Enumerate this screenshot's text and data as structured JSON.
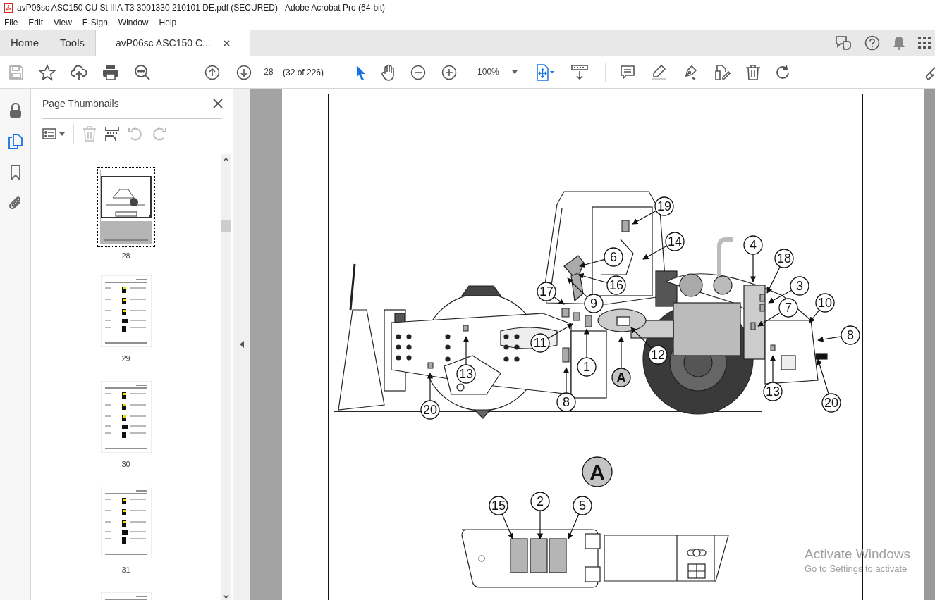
{
  "window": {
    "title": "avP06sc ASC150 CU St IIIA T3 3001330 210101 DE.pdf (SECURED) - Adobe Acrobat Pro (64-bit)"
  },
  "menu": [
    "File",
    "Edit",
    "View",
    "E-Sign",
    "Window",
    "Help"
  ],
  "tabs": [
    {
      "label": "Home",
      "kind": "nav",
      "selected": false
    },
    {
      "label": "Tools",
      "kind": "nav",
      "selected": false
    },
    {
      "label": "avP06sc ASC150 C...",
      "kind": "document",
      "selected": true
    }
  ],
  "toolbar": {
    "page_number": "28",
    "page_count": "(32 of 226)",
    "zoom": "100%",
    "tools": [
      {
        "kind": "select",
        "selected": true
      },
      {
        "kind": "hand",
        "selected": false
      }
    ]
  },
  "rail": [
    {
      "kind": "lock",
      "selected": false
    },
    {
      "kind": "pages",
      "selected": true
    },
    {
      "kind": "bookmark",
      "selected": false
    },
    {
      "kind": "attachment",
      "selected": false
    }
  ],
  "sidebar": {
    "title": "Page Thumbnails",
    "thumbnails": [
      {
        "page": "28",
        "kind": "drawing",
        "selected": true
      },
      {
        "page": "29",
        "kind": "table",
        "selected": false
      },
      {
        "page": "30",
        "kind": "table",
        "selected": false
      },
      {
        "page": "31",
        "kind": "table",
        "selected": false
      },
      {
        "kind": "table",
        "selected": false
      }
    ]
  },
  "document": {
    "callouts": [
      {
        "label": "19",
        "kind": "number"
      },
      {
        "label": "14",
        "kind": "number"
      },
      {
        "label": "6",
        "kind": "number"
      },
      {
        "label": "16",
        "kind": "number"
      },
      {
        "label": "9",
        "kind": "number"
      },
      {
        "label": "17",
        "kind": "number"
      },
      {
        "label": "11",
        "kind": "number"
      },
      {
        "label": "13",
        "kind": "number"
      },
      {
        "label": "20",
        "kind": "number"
      },
      {
        "label": "8",
        "kind": "number"
      },
      {
        "label": "1",
        "kind": "number"
      },
      {
        "label": "A",
        "kind": "view"
      },
      {
        "label": "12",
        "kind": "number"
      },
      {
        "label": "4",
        "kind": "number"
      },
      {
        "label": "18",
        "kind": "number"
      },
      {
        "label": "3",
        "kind": "number"
      },
      {
        "label": "7",
        "kind": "number"
      },
      {
        "label": "10",
        "kind": "number"
      },
      {
        "label": "8",
        "kind": "number"
      },
      {
        "label": "13",
        "kind": "number"
      },
      {
        "label": "20",
        "kind": "number"
      }
    ],
    "detail_title": "A",
    "detail_callouts": [
      {
        "label": "15",
        "kind": "number"
      },
      {
        "label": "2",
        "kind": "number"
      },
      {
        "label": "5",
        "kind": "number"
      }
    ]
  },
  "os_notice": {
    "title": "Activate Windows",
    "subtitle": "Go to Settings to activate"
  }
}
